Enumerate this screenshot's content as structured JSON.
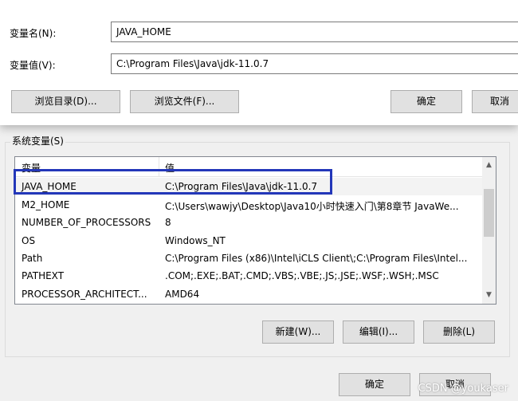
{
  "edit_dialog": {
    "name_label": "变量名(N):",
    "name_value": "JAVA_HOME",
    "value_label": "变量值(V):",
    "value_value": "C:\\Program Files\\Java\\jdk-11.0.7",
    "browse_dir": "浏览目录(D)...",
    "browse_file": "浏览文件(F)...",
    "ok": "确定",
    "cancel": "取消"
  },
  "system_vars": {
    "group_title": "系统变量(S)",
    "headers": [
      "变量",
      "值"
    ],
    "rows": [
      {
        "name": "JAVA_HOME",
        "value": "C:\\Program Files\\Java\\jdk-11.0.7"
      },
      {
        "name": "M2_HOME",
        "value": "C:\\Users\\wawjy\\Desktop\\Java10小时快速入门\\第8章节 JavaWe..."
      },
      {
        "name": "NUMBER_OF_PROCESSORS",
        "value": "8"
      },
      {
        "name": "OS",
        "value": "Windows_NT"
      },
      {
        "name": "Path",
        "value": "C:\\Program Files (x86)\\Intel\\iCLS Client\\;C:\\Program Files\\Intel..."
      },
      {
        "name": "PATHEXT",
        "value": ".COM;.EXE;.BAT;.CMD;.VBS;.VBE;.JS;.JSE;.WSF;.WSH;.MSC"
      },
      {
        "name": "PROCESSOR_ARCHITECT...",
        "value": "AMD64"
      }
    ],
    "new_btn": "新建(W)...",
    "edit_btn": "编辑(I)...",
    "delete_btn": "删除(L)"
  },
  "footer": {
    "ok": "确定",
    "cancel": "取消"
  },
  "watermark": "CSDN @youkaser"
}
